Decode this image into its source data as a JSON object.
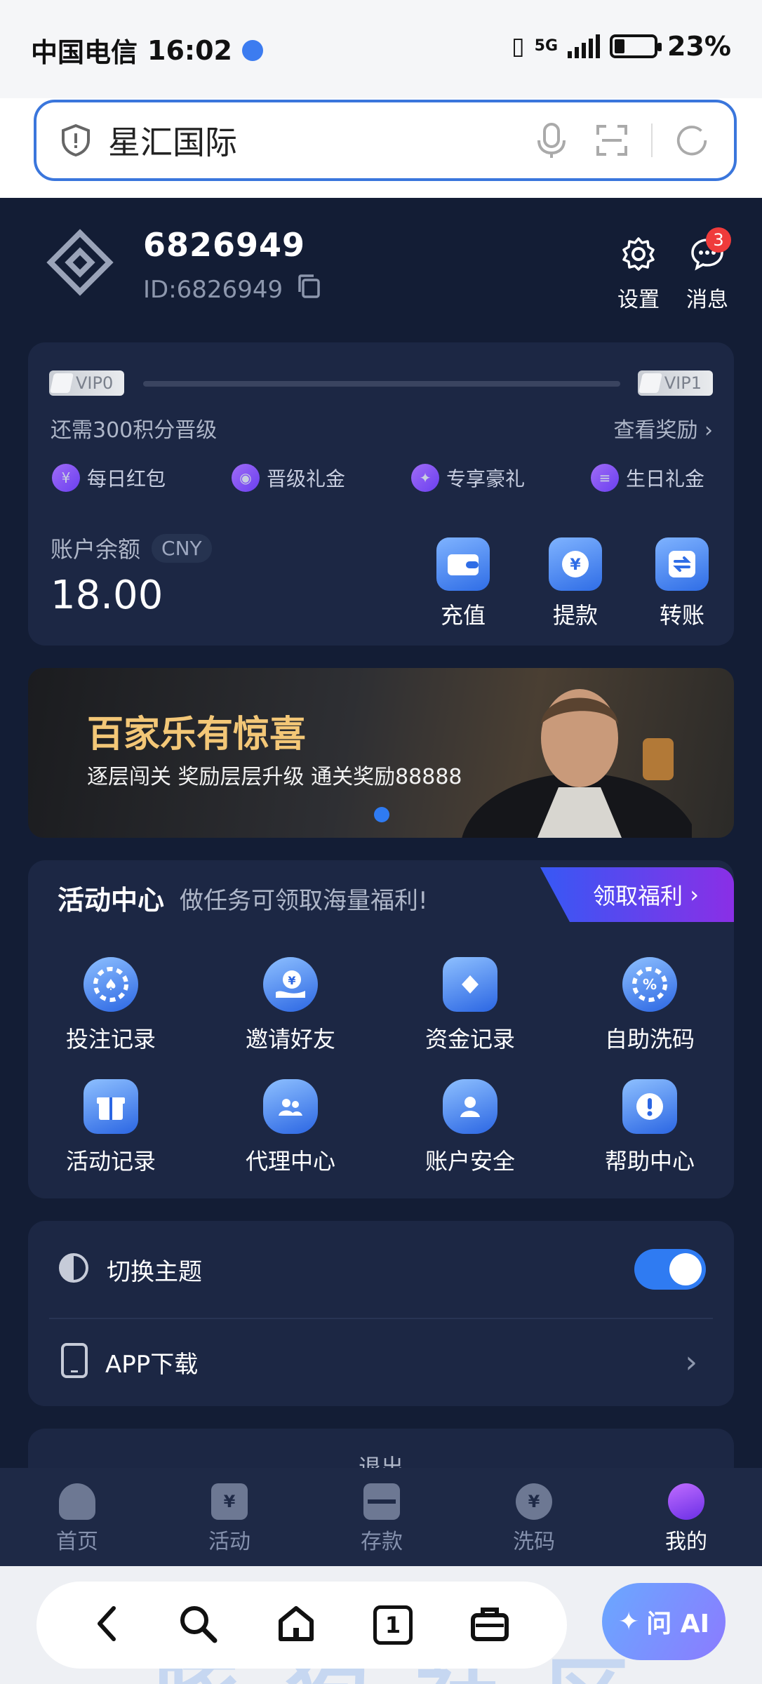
{
  "status_bar": {
    "carrier": "中国电信",
    "time": "16:02",
    "network": "5G",
    "battery": "23%"
  },
  "search": {
    "query": "星汇国际"
  },
  "profile": {
    "username": "6826949",
    "id_text": "ID:6826949",
    "settings_label": "设置",
    "messages_label": "消息",
    "messages_badge": "3"
  },
  "vip": {
    "current": "VIP0",
    "next": "VIP1",
    "need_text": "还需300积分晋级",
    "view_rewards": "查看奖励",
    "progress": 0,
    "perks": [
      "每日红包",
      "晋级礼金",
      "专享豪礼",
      "生日礼金"
    ]
  },
  "balance": {
    "label": "账户余额",
    "currency": "CNY",
    "value": "18.00"
  },
  "quick_actions": [
    "充值",
    "提款",
    "转账"
  ],
  "banner": {
    "title": "百家乐有惊喜",
    "subtitle": "逐层闯关 奖励层层升级  通关奖励88888"
  },
  "activity": {
    "title": "活动中心",
    "desc": "做任务可领取海量福利!",
    "claim_button": "领取福利",
    "items": [
      "投注记录",
      "邀请好友",
      "资金记录",
      "自助洗码",
      "活动记录",
      "代理中心",
      "账户安全",
      "帮助中心"
    ]
  },
  "settings": {
    "theme_label": "切换主题",
    "theme_on": true,
    "app_download": "APP下载"
  },
  "logout": {
    "label": "退出"
  },
  "tabbar": {
    "tabs": [
      "首页",
      "活动",
      "存款",
      "洗码",
      "我的"
    ],
    "active": "我的"
  },
  "browser": {
    "tab_count": "1",
    "ai_label": "问 AI"
  },
  "colors": {
    "accent": "#2f7bf2",
    "background": "#131d35",
    "card": "#1c2744"
  }
}
